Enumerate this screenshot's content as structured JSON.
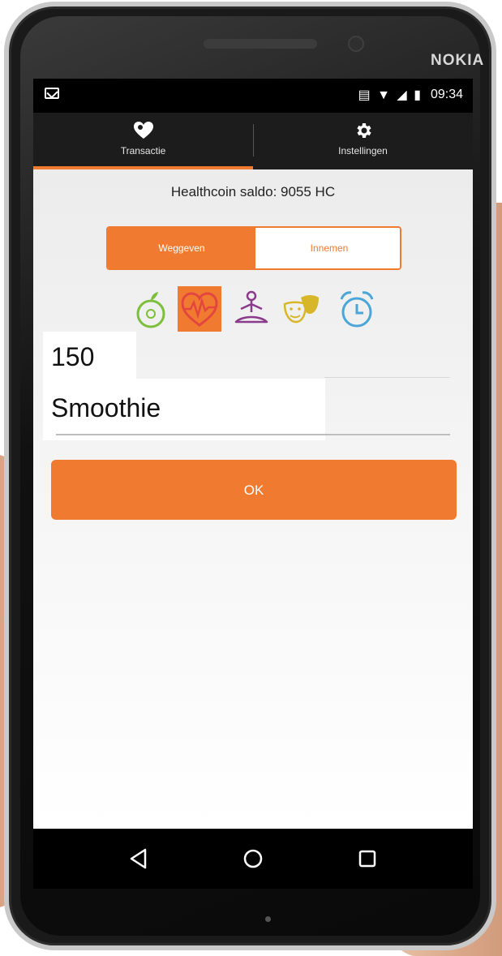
{
  "device": {
    "brand": "NOKIA"
  },
  "statusbar": {
    "time": "09:34",
    "icons": "vibrate-icon wifi-icon signal-icon battery-icon"
  },
  "tabs": [
    {
      "label": "Transactie",
      "icon": "heart-coin-icon",
      "selected": true
    },
    {
      "label": "Instellingen",
      "icon": "gear-icon",
      "selected": false
    }
  ],
  "balance": {
    "text": "Healthcoin saldo: 9055 HC"
  },
  "toggle": {
    "left_label": "Weggeven",
    "right_label": "Innemen",
    "selected": "Weggeven"
  },
  "categories": [
    {
      "icon": "apple-icon",
      "color": "#7cbf3b",
      "selected": false
    },
    {
      "icon": "heartbeat-icon",
      "color": "#e3463f",
      "selected": true
    },
    {
      "icon": "meditation-icon",
      "color": "#8a3b8c",
      "selected": false
    },
    {
      "icon": "theater-masks-icon",
      "color": "#d8b62a",
      "selected": false
    },
    {
      "icon": "alarm-clock-icon",
      "color": "#4aa6d6",
      "selected": false
    }
  ],
  "form": {
    "amount": "150",
    "description": "Smoothie"
  },
  "ok_button": {
    "label": "OK"
  },
  "colors": {
    "accent": "#f07a30",
    "tabbar": "#1c1c1c",
    "statusbar": "#000000"
  },
  "navbar": {
    "buttons": [
      "back-icon",
      "home-icon",
      "recent-apps-icon"
    ]
  }
}
